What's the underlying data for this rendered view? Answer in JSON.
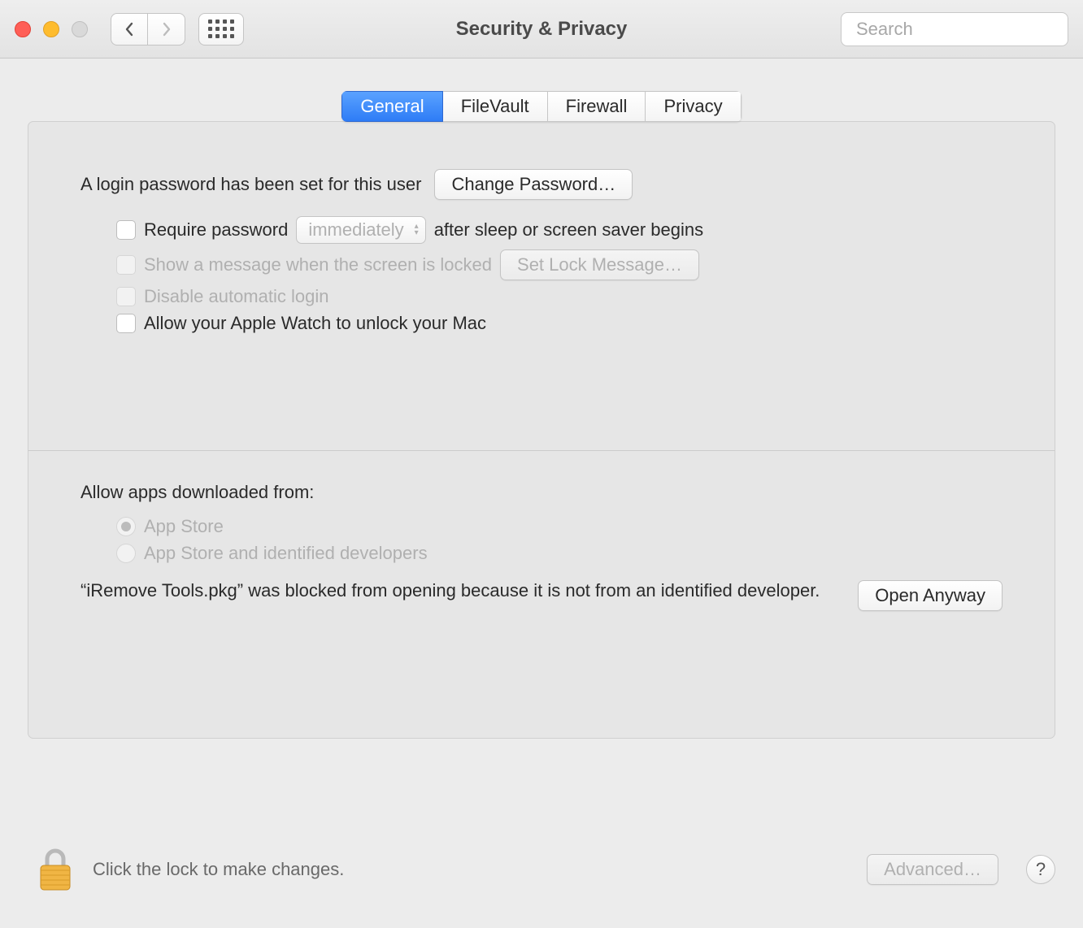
{
  "window": {
    "title": "Security & Privacy",
    "search_placeholder": "Search"
  },
  "tabs": {
    "general": "General",
    "filevault": "FileVault",
    "firewall": "Firewall",
    "privacy": "Privacy",
    "active": "general"
  },
  "general": {
    "login_password_set": "A login password has been set for this user",
    "change_password_btn": "Change Password…",
    "require_password_label": "Require password",
    "require_password_delay": "immediately",
    "require_password_suffix": "after sleep or screen saver begins",
    "show_lock_message_label": "Show a message when the screen is locked",
    "set_lock_message_btn": "Set Lock Message…",
    "disable_auto_login_label": "Disable automatic login",
    "apple_watch_label": "Allow your Apple Watch to unlock your Mac",
    "allow_apps_heading": "Allow apps downloaded from:",
    "radio_app_store": "App Store",
    "radio_identified": "App Store and identified developers",
    "blocked_message": "“iRemove Tools.pkg” was blocked from opening because it is not from an identified developer.",
    "open_anyway_btn": "Open Anyway"
  },
  "footer": {
    "lock_hint": "Click the lock to make changes.",
    "advanced_btn": "Advanced…",
    "help_label": "?"
  }
}
